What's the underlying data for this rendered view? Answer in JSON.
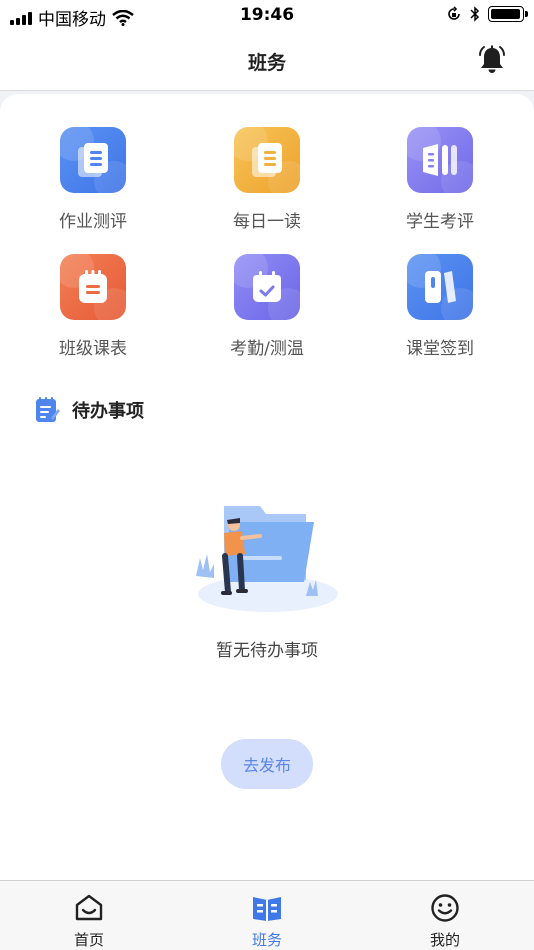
{
  "status_bar": {
    "carrier": "中国移动",
    "time": "19:46",
    "battery_level": 0.95
  },
  "header": {
    "title": "班务",
    "bell_icon": "bell-icon"
  },
  "grid": [
    {
      "label": "作业测评",
      "icon": "homework-icon",
      "color": "#4f86ee"
    },
    {
      "label": "每日一读",
      "icon": "daily-read-icon",
      "color": "#f1b13e"
    },
    {
      "label": "学生考评",
      "icon": "books-icon",
      "color": "#8580f2"
    },
    {
      "label": "班级课表",
      "icon": "schedule-icon",
      "color": "#ec6a44"
    },
    {
      "label": "考勤/测温",
      "icon": "calendar-check-icon",
      "color": "#7d79ef"
    },
    {
      "label": "课堂签到",
      "icon": "sign-in-icon",
      "color": "#4f86ee"
    }
  ],
  "todo": {
    "title": "待办事项",
    "empty_text": "暂无待办事项",
    "publish_label": "去发布"
  },
  "tabs": [
    {
      "label": "首页",
      "icon": "home-icon",
      "active": false
    },
    {
      "label": "班务",
      "icon": "class-affairs-icon",
      "active": true
    },
    {
      "label": "我的",
      "icon": "smiley-icon",
      "active": false
    }
  ],
  "colors": {
    "accent": "#3f78e8",
    "publish_bg": "#d3defc"
  }
}
